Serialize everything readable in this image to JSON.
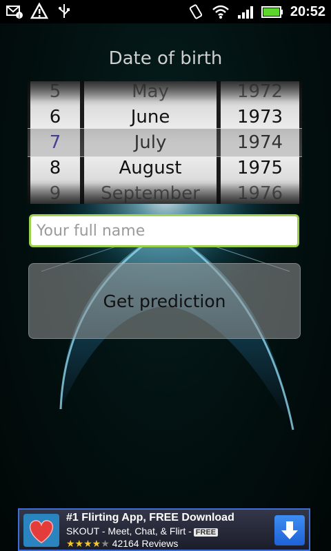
{
  "status_bar": {
    "time": "20:52",
    "left_icons": [
      "mail-notification-icon",
      "warning-icon",
      "usb-icon"
    ],
    "right_icons": [
      "vibrate-icon",
      "wifi-icon",
      "signal-icon",
      "battery-icon"
    ]
  },
  "title": "Date of birth",
  "picker": {
    "days": [
      "5",
      "6",
      "7",
      "8",
      "9"
    ],
    "months": [
      "May",
      "June",
      "July",
      "August",
      "September"
    ],
    "years": [
      "1972",
      "1973",
      "1974",
      "1975",
      "1976"
    ],
    "selected": {
      "day": "7",
      "month": "July",
      "year": "1974"
    }
  },
  "name_input": {
    "placeholder": "Your full name",
    "value": ""
  },
  "predict_button": {
    "label": "Get prediction"
  },
  "ad": {
    "title": "#1 Flirting App, FREE Download",
    "subtitle": "SKOUT - Meet, Chat, & Flirt -",
    "free_badge": "FREE",
    "stars": "★★★★",
    "star_off": "★",
    "reviews": "42164 Reviews",
    "rating_value": 4
  },
  "colors": {
    "input_border": "#9bd14c",
    "selected_day": "#2c2ca6",
    "ad_border": "#3f6fd6",
    "download_button": "#1f62d6"
  }
}
